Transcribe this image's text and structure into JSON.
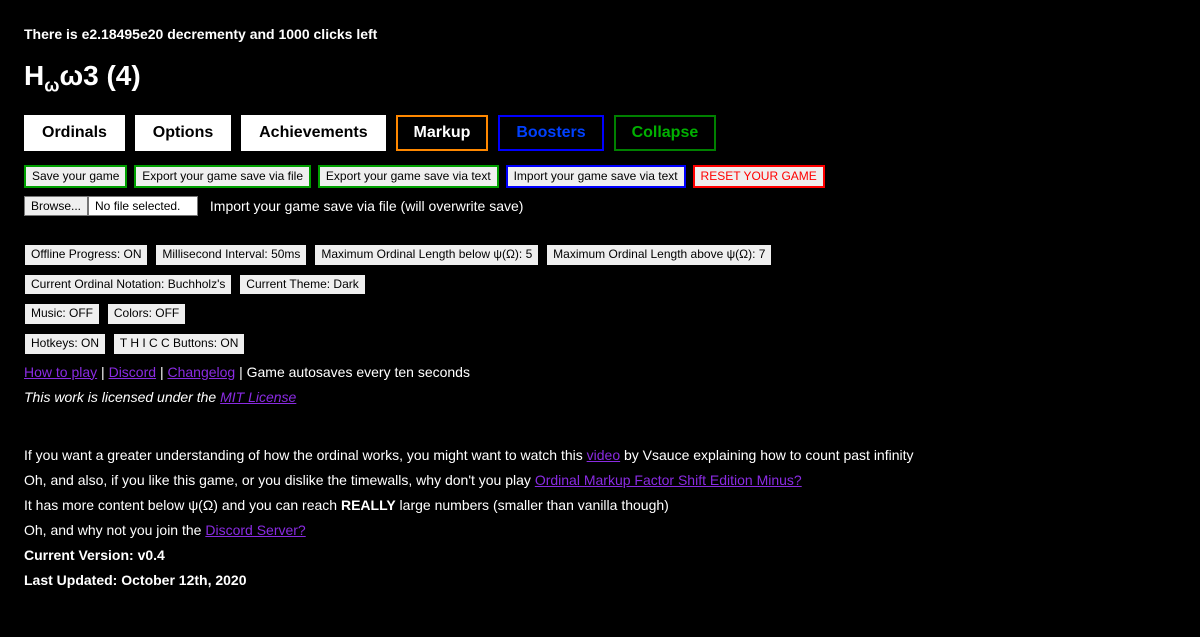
{
  "status": "There is e2.18495e20 decrementy and 1000 clicks left",
  "ordinal_html": "H<sub>ω</sub>ω3 (4)",
  "tabs": {
    "ordinals": "Ordinals",
    "options": "Options",
    "achievements": "Achievements",
    "markup": "Markup",
    "boosters": "Boosters",
    "collapse": "Collapse"
  },
  "save_row": {
    "save": "Save your game",
    "export_file": "Export your game save via file",
    "export_text": "Export your game save via text",
    "import_text": "Import your game save via text",
    "reset": "RESET YOUR GAME"
  },
  "file_row": {
    "browse": "Browse...",
    "no_file": "No file selected.",
    "label": "Import your game save via file (will overwrite save)"
  },
  "settings1": {
    "offline": "Offline Progress: ON",
    "interval": "Millisecond Interval: 50ms",
    "max_below": "Maximum Ordinal Length below ψ(Ω): 5",
    "max_above": "Maximum Ordinal Length above ψ(Ω): 7"
  },
  "settings2": {
    "notation": "Current Ordinal Notation: Buchholz's",
    "theme": "Current Theme: Dark"
  },
  "settings3": {
    "music": "Music: OFF",
    "colors": "Colors: OFF"
  },
  "settings4": {
    "hotkeys": "Hotkeys: ON",
    "thicc": "T H I C C Buttons: ON"
  },
  "links_row": {
    "howto": "How to play",
    "discord": "Discord",
    "changelog": "Changelog",
    "autosave": "Game autosaves every ten seconds"
  },
  "license": {
    "prefix": "This work is licensed under the ",
    "link": "MIT License"
  },
  "body1": {
    "prefix": "If you want a greater understanding of how the ordinal works, you might want to watch this ",
    "link": "video",
    "suffix": " by Vsauce explaining how to count past infinity"
  },
  "body2": {
    "prefix": "Oh, and also, if you like this game, or you dislike the timewalls, why don't you play ",
    "link": "Ordinal Markup Factor Shift Edition Minus?"
  },
  "body3": {
    "p1": "It has more content below ψ(Ω) and you can reach ",
    "bold": "REALLY",
    "p2": " large numbers (smaller than vanilla though)"
  },
  "body4": {
    "prefix": "Oh, and why not you join the ",
    "link": "Discord Server?"
  },
  "version": "Current Version: v0.4",
  "updated": "Last Updated: October 12th, 2020"
}
